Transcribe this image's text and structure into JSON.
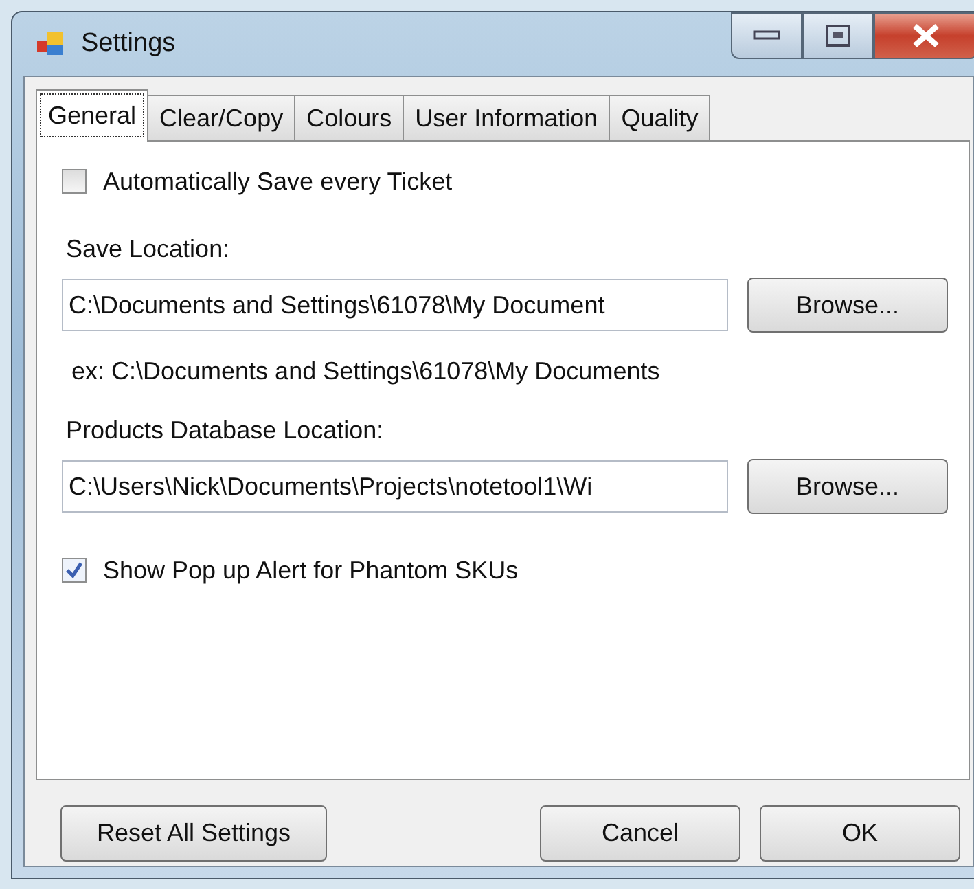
{
  "window": {
    "title": "Settings"
  },
  "tabs": [
    {
      "label": "General",
      "selected": true
    },
    {
      "label": "Clear/Copy",
      "selected": false
    },
    {
      "label": "Colours",
      "selected": false
    },
    {
      "label": "User Information",
      "selected": false
    },
    {
      "label": "Quality",
      "selected": false
    }
  ],
  "general": [
    {
      "kind": "checkbox",
      "label": "Automatically Save every Ticket",
      "checked": false
    },
    {
      "kind": "label",
      "text": "Save Location:"
    },
    {
      "kind": "path",
      "value": "C:\\Documents and Settings\\61078\\My Document",
      "button": "Browse..."
    },
    {
      "kind": "hint",
      "text": "ex: C:\\Documents and Settings\\61078\\My Documents"
    },
    {
      "kind": "label",
      "text": "Products Database Location:"
    },
    {
      "kind": "path",
      "value": "C:\\Users\\Nick\\Documents\\Projects\\notetool1\\Wi",
      "button": "Browse..."
    },
    {
      "kind": "checkbox",
      "label": "Show Pop up Alert for Phantom SKUs",
      "checked": true
    }
  ],
  "buttons": [
    {
      "label": "Reset All Settings",
      "kind": "left"
    },
    {
      "label": "Cancel",
      "kind": "right"
    },
    {
      "label": "OK",
      "kind": "right"
    }
  ]
}
